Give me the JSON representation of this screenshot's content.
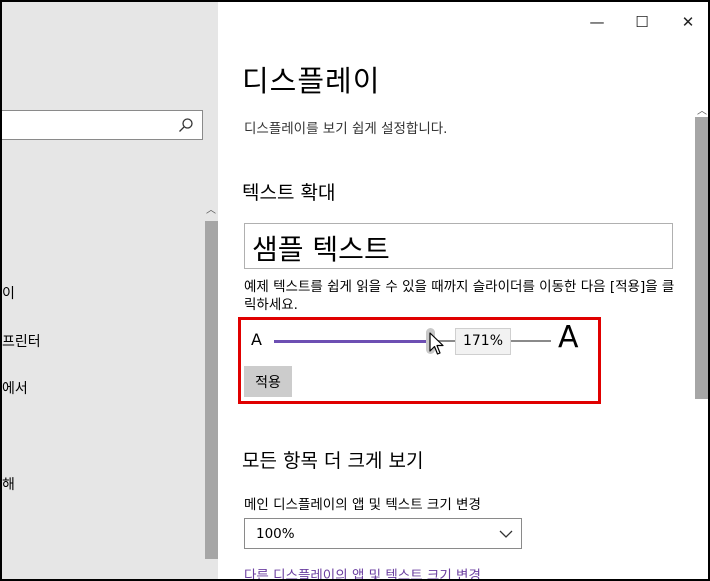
{
  "nav": {
    "search_placeholder": "",
    "items": [
      "이",
      "프린터",
      "에서",
      "해"
    ]
  },
  "window": {
    "minimize_glyph": "—",
    "maximize_glyph": "☐",
    "close_glyph": "✕"
  },
  "page": {
    "title": "디스플레이",
    "description": "디스플레이를 보기 쉽게 설정합니다."
  },
  "text_size": {
    "heading": "텍스트 확대",
    "sample_text": "샘플 텍스트",
    "instruction": "예제 텍스트를 쉽게 읽을 수 있을 때까지 슬라이더를 이동한 다음 [적용]을 클릭하세요.",
    "small_a": "A",
    "large_a": "A",
    "slider_value_label": "171%",
    "slider_value": 171,
    "apply_label": "적용"
  },
  "scale": {
    "heading": "모든 항목 더 크게 보기",
    "label": "메인 디스플레이의 앱 및 텍스트 크기 변경",
    "selected": "100%",
    "link": "다른 디스플레이의 앱 및 텍스트 크기 변경"
  },
  "colors": {
    "slider_accent": "#6d4fb3",
    "highlight_border": "#e00000",
    "link": "#6b3fa0"
  }
}
